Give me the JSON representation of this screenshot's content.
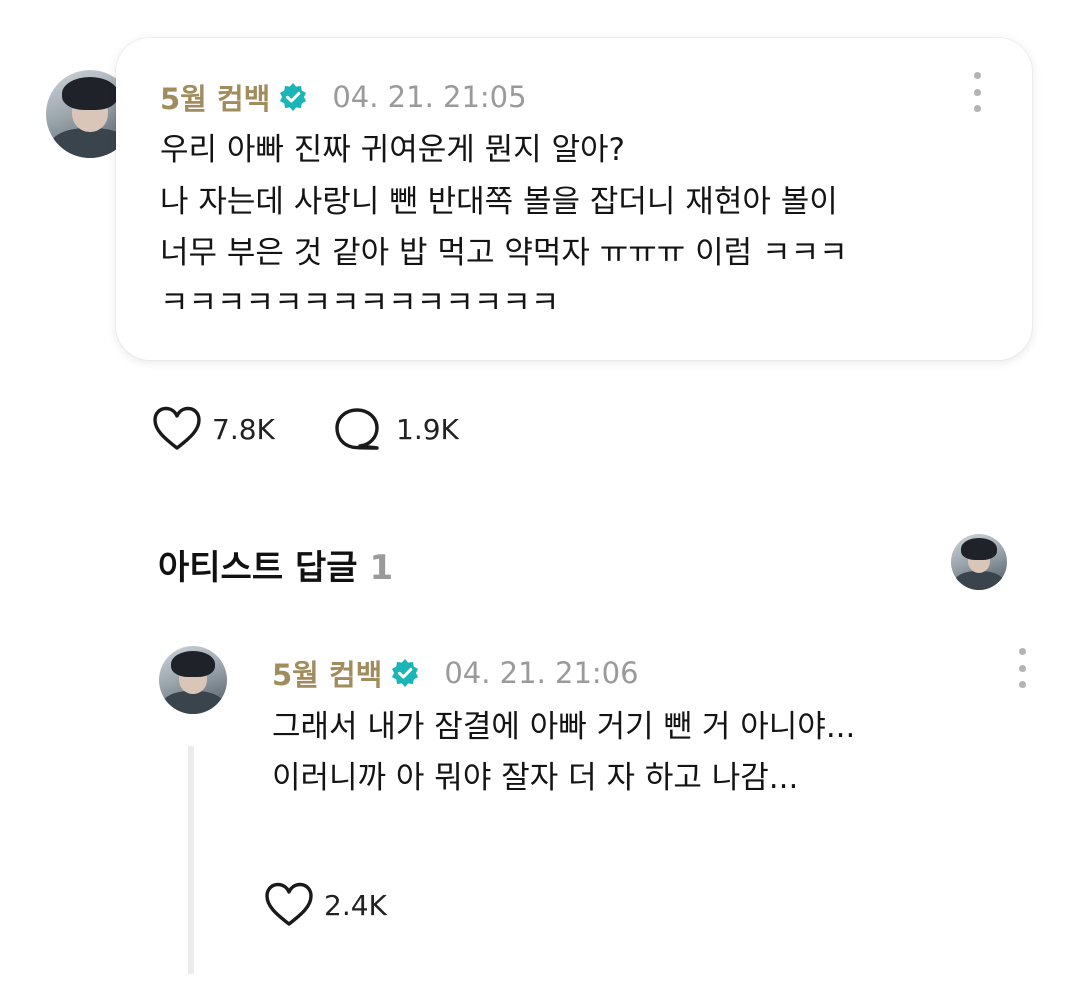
{
  "post": {
    "author": "5월 컴백",
    "timestamp": "04. 21. 21:05",
    "lines": [
      "우리 아빠 진짜 귀여운게 뭔지 알아?",
      "나 자는데 사랑니 뺀 반대쪽 볼을 잡더니 재현아 볼이",
      "너무 부은 것 같아 밥 먹고 약먹자 ㅠㅠㅠ 이럼 ㅋㅋㅋ",
      "ㅋㅋㅋㅋㅋㅋㅋㅋㅋㅋㅋㅋㅋㅋ"
    ],
    "likes": "7.8K",
    "comments": "1.9K"
  },
  "section": {
    "title": "아티스트 답글",
    "count": "1"
  },
  "reply": {
    "author": "5월 컴백",
    "timestamp": "04. 21. 21:06",
    "lines": [
      "그래서 내가 잠결에 아빠 거기 뺀 거 아니야...",
      "이러니까 아 뭐야 잘자 더 자 하고 나감..."
    ],
    "likes": "2.4K"
  },
  "icons": {
    "verified": "verified-badge-icon",
    "like": "heart-icon",
    "comment": "comment-bubble-icon",
    "more": "more-vertical-icon"
  },
  "colors": {
    "author": "#a08c5c",
    "verified": "#1bb5b8",
    "timestamp": "#9a9a9a"
  }
}
